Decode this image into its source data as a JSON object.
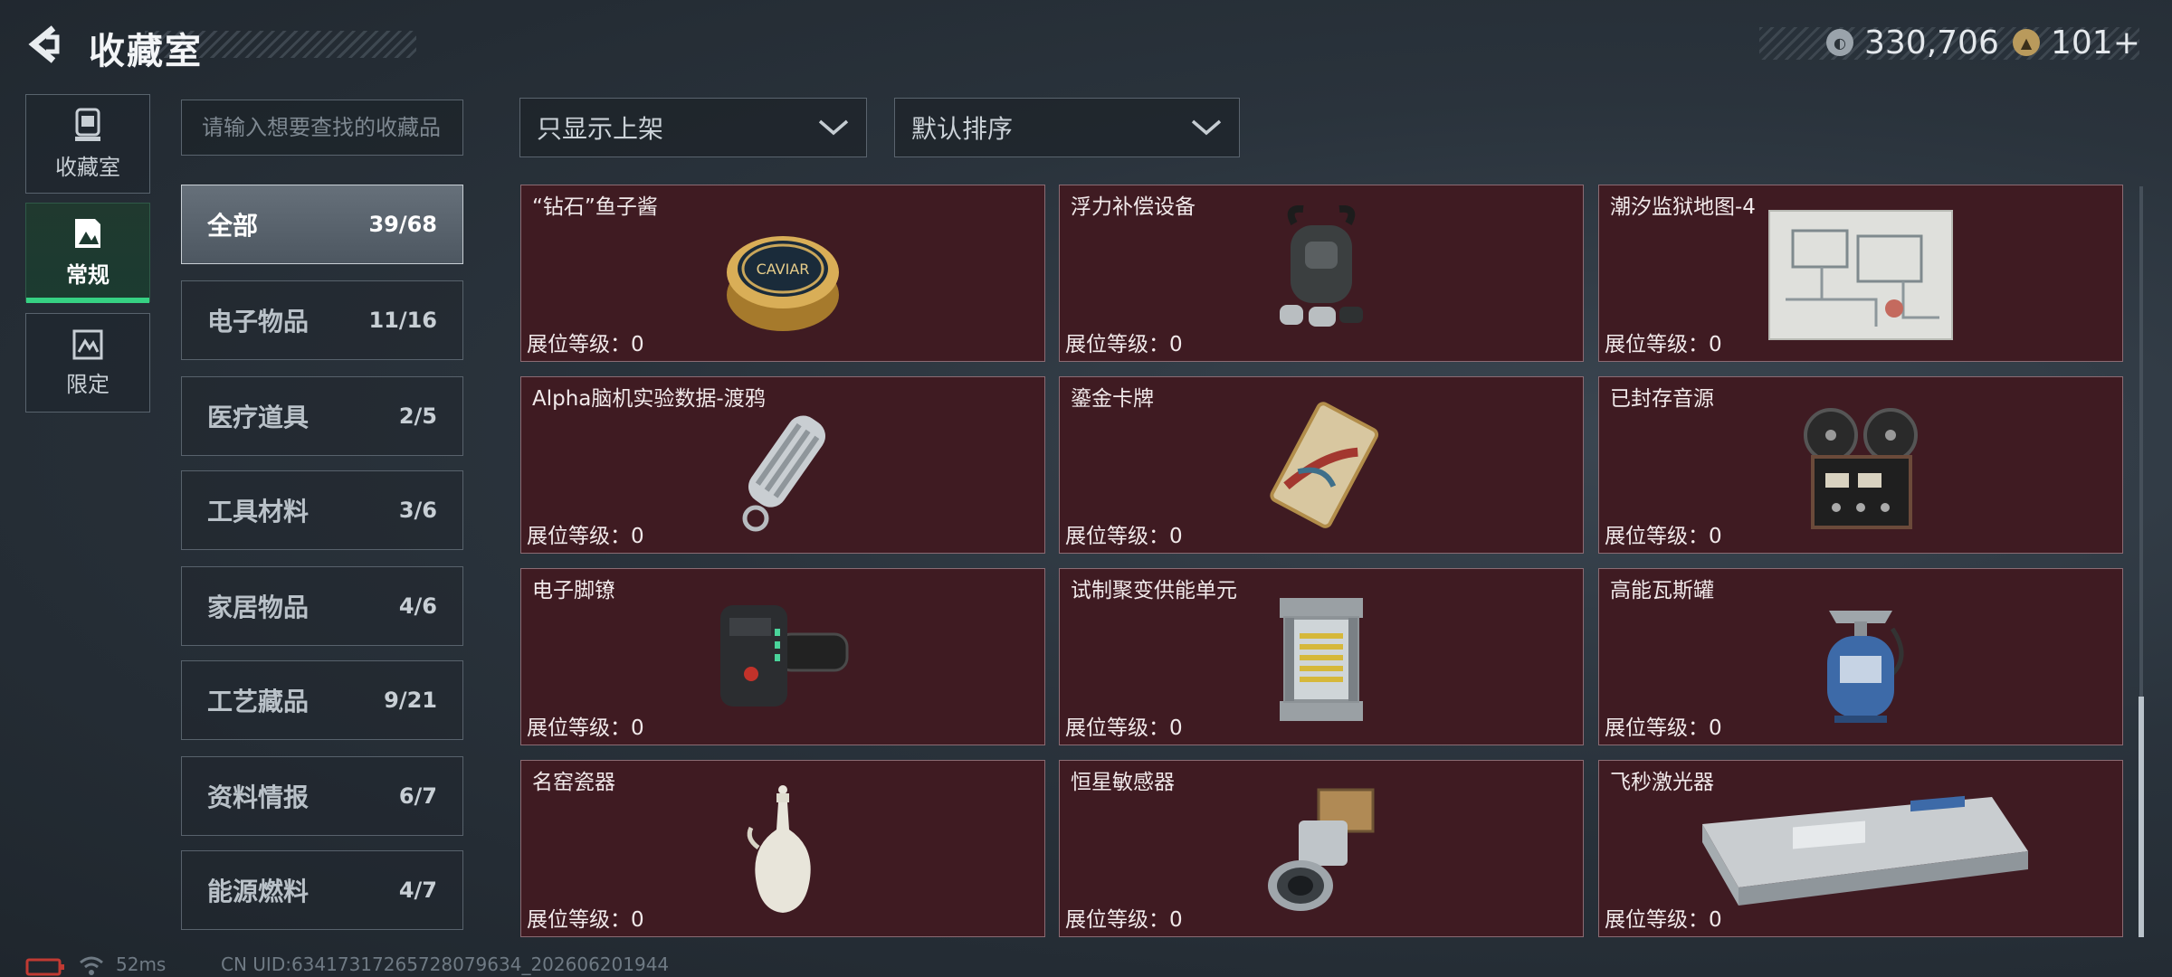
{
  "header": {
    "title": "收藏室",
    "currency_primary": "330,706",
    "currency_secondary": "101+",
    "add_symbol": "+"
  },
  "side_nav": [
    {
      "label": "收藏室",
      "icon": "trophy-icon",
      "active": false
    },
    {
      "label": "常规",
      "icon": "image-icon",
      "active": true
    },
    {
      "label": "限定",
      "icon": "limited-icon",
      "active": false
    }
  ],
  "search": {
    "placeholder": "请输入想要查找的收藏品"
  },
  "categories": [
    {
      "name": "全部",
      "count": "39/68",
      "active": true
    },
    {
      "name": "电子物品",
      "count": "11/16"
    },
    {
      "name": "医疗道具",
      "count": "2/5"
    },
    {
      "name": "工具材料",
      "count": "3/6"
    },
    {
      "name": "家居物品",
      "count": "4/6"
    },
    {
      "name": "工艺藏品",
      "count": "9/21"
    },
    {
      "name": "资料情报",
      "count": "6/7"
    },
    {
      "name": "能源燃料",
      "count": "4/7"
    }
  ],
  "filters": {
    "display": "只显示上架",
    "sort": "默认排序"
  },
  "items": [
    {
      "name": "“钻石”鱼子酱",
      "level": "展位等级：0",
      "icon": "caviar-tin-icon"
    },
    {
      "name": "浮力补偿设备",
      "level": "展位等级：0",
      "icon": "buoyancy-device-icon"
    },
    {
      "name": "潮汐监狱地图-4",
      "level": "展位等级：0",
      "icon": "map-icon"
    },
    {
      "name": "Alpha脑机实验数据-渡鸦",
      "level": "展位等级：0",
      "icon": "data-capsule-icon"
    },
    {
      "name": "鎏金卡牌",
      "level": "展位等级：0",
      "icon": "gold-card-icon"
    },
    {
      "name": "已封存音源",
      "level": "展位等级：0",
      "icon": "tape-recorder-icon"
    },
    {
      "name": "电子脚镣",
      "level": "展位等级：0",
      "icon": "ankle-monitor-icon"
    },
    {
      "name": "试制聚变供能单元",
      "level": "展位等级：0",
      "icon": "fusion-unit-icon"
    },
    {
      "name": "高能瓦斯罐",
      "level": "展位等级：0",
      "icon": "gas-canister-icon"
    },
    {
      "name": "名窑瓷器",
      "level": "展位等级：0",
      "icon": "porcelain-vase-icon"
    },
    {
      "name": "恒星敏感器",
      "level": "展位等级：0",
      "icon": "star-sensor-icon"
    },
    {
      "name": "飞秒激光器",
      "level": "展位等级：0",
      "icon": "laser-device-icon"
    }
  ],
  "footer": {
    "ping": "52ms",
    "uid": "CN UID:634173172657280796​34_202606201944"
  }
}
